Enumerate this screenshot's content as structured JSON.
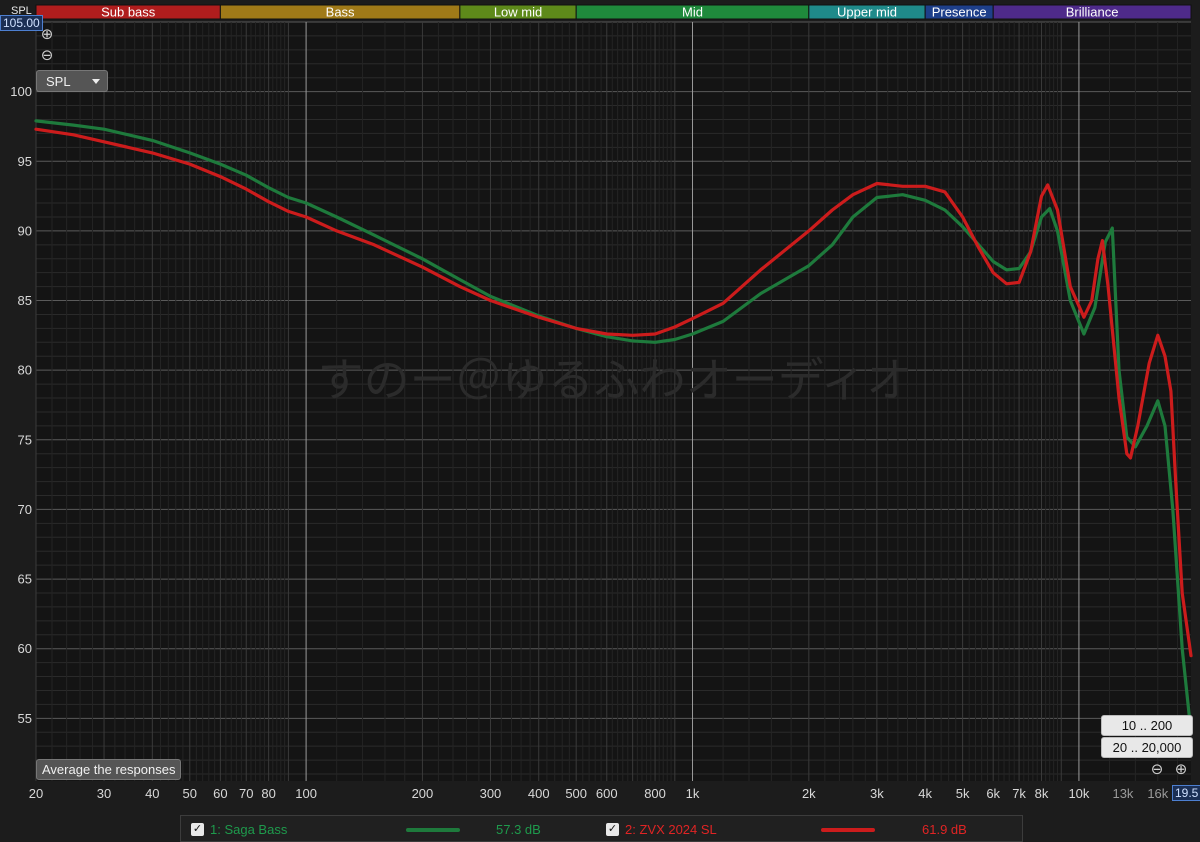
{
  "axis": {
    "title": "SPL",
    "top_value": "105.00",
    "right_value": "19.5"
  },
  "controls": {
    "spl_select": "SPL",
    "average_button": "Average the responses",
    "range_button_1": "10 .. 200",
    "range_button_2": "20 .. 20,000",
    "zoom_in": "⊕",
    "zoom_out": "⊖"
  },
  "bands": [
    {
      "label": "Sub bass",
      "from": 20,
      "to": 60,
      "color": "#b01d1d",
      "text": "#ffffff"
    },
    {
      "label": "Bass",
      "from": 60,
      "to": 250,
      "color": "#a07a18",
      "text": "#ffffff"
    },
    {
      "label": "Low mid",
      "from": 250,
      "to": 500,
      "color": "#5e8a1a",
      "text": "#ffffff"
    },
    {
      "label": "Mid",
      "from": 500,
      "to": 2000,
      "color": "#1f8a3c",
      "text": "#ffffff"
    },
    {
      "label": "Upper mid",
      "from": 2000,
      "to": 4000,
      "color": "#1f8a8a",
      "text": "#ffffff"
    },
    {
      "label": "Presence",
      "from": 4000,
      "to": 6000,
      "color": "#1e3f8a",
      "text": "#ffffff"
    },
    {
      "label": "Brilliance",
      "from": 6000,
      "to": 20000,
      "color": "#4e2a8a",
      "text": "#ffffff"
    }
  ],
  "watermark": "すのー＠ゆるふわオーディオ",
  "chart_data": {
    "type": "line",
    "xscale": "log",
    "xlim": [
      20,
      19500
    ],
    "ylim": [
      50.5,
      105
    ],
    "grid": true,
    "y_ticks": [
      55,
      60,
      65,
      70,
      75,
      80,
      85,
      90,
      95,
      100
    ],
    "x_ticks": [
      {
        "value": 20,
        "label": "20"
      },
      {
        "value": 30,
        "label": "30"
      },
      {
        "value": 40,
        "label": "40"
      },
      {
        "value": 50,
        "label": "50"
      },
      {
        "value": 60,
        "label": "60"
      },
      {
        "value": 70,
        "label": "70"
      },
      {
        "value": 80,
        "label": "80"
      },
      {
        "value": 100,
        "label": "100"
      },
      {
        "value": 200,
        "label": "200"
      },
      {
        "value": 300,
        "label": "300"
      },
      {
        "value": 400,
        "label": "400"
      },
      {
        "value": 500,
        "label": "500"
      },
      {
        "value": 600,
        "label": "600"
      },
      {
        "value": 800,
        "label": "800"
      },
      {
        "value": 1000,
        "label": "1k"
      },
      {
        "value": 2000,
        "label": "2k"
      },
      {
        "value": 3000,
        "label": "3k"
      },
      {
        "value": 4000,
        "label": "4k"
      },
      {
        "value": 5000,
        "label": "5k"
      },
      {
        "value": 6000,
        "label": "6k"
      },
      {
        "value": 7000,
        "label": "7k"
      },
      {
        "value": 8000,
        "label": "8k"
      },
      {
        "value": 10000,
        "label": "10k"
      },
      {
        "value": 13000,
        "label": "13k"
      },
      {
        "value": 16000,
        "label": "16k"
      }
    ],
    "series": [
      {
        "name": "1: Saga Bass",
        "color": "#1e7a3c",
        "legend_value": "57.3 dB",
        "points": [
          [
            20,
            97.9
          ],
          [
            25,
            97.6
          ],
          [
            30,
            97.3
          ],
          [
            40,
            96.5
          ],
          [
            50,
            95.6
          ],
          [
            60,
            94.8
          ],
          [
            70,
            94.0
          ],
          [
            80,
            93.1
          ],
          [
            90,
            92.4
          ],
          [
            100,
            92.0
          ],
          [
            120,
            91.0
          ],
          [
            150,
            89.7
          ],
          [
            200,
            88.0
          ],
          [
            250,
            86.5
          ],
          [
            300,
            85.3
          ],
          [
            400,
            83.9
          ],
          [
            500,
            83.0
          ],
          [
            600,
            82.4
          ],
          [
            700,
            82.1
          ],
          [
            800,
            82.0
          ],
          [
            900,
            82.2
          ],
          [
            1000,
            82.6
          ],
          [
            1200,
            83.5
          ],
          [
            1500,
            85.5
          ],
          [
            2000,
            87.5
          ],
          [
            2300,
            89.0
          ],
          [
            2600,
            91.0
          ],
          [
            3000,
            92.4
          ],
          [
            3500,
            92.6
          ],
          [
            4000,
            92.2
          ],
          [
            4500,
            91.5
          ],
          [
            5000,
            90.3
          ],
          [
            5500,
            89.0
          ],
          [
            6000,
            87.8
          ],
          [
            6500,
            87.2
          ],
          [
            7000,
            87.3
          ],
          [
            7500,
            88.5
          ],
          [
            8000,
            91.0
          ],
          [
            8400,
            91.6
          ],
          [
            8800,
            90.0
          ],
          [
            9500,
            85.0
          ],
          [
            10300,
            82.6
          ],
          [
            11000,
            84.5
          ],
          [
            11700,
            89.2
          ],
          [
            12200,
            90.2
          ],
          [
            12700,
            80.0
          ],
          [
            13300,
            75.2
          ],
          [
            14000,
            74.5
          ],
          [
            15000,
            76.0
          ],
          [
            16000,
            77.8
          ],
          [
            16700,
            76.0
          ],
          [
            17500,
            70.0
          ],
          [
            18500,
            60.0
          ],
          [
            19500,
            54.0
          ]
        ]
      },
      {
        "name": "2: ZVX 2024 SL",
        "color": "#cc1c1c",
        "legend_value": "61.9 dB",
        "points": [
          [
            20,
            97.3
          ],
          [
            25,
            96.9
          ],
          [
            30,
            96.4
          ],
          [
            40,
            95.6
          ],
          [
            50,
            94.8
          ],
          [
            60,
            93.9
          ],
          [
            70,
            93.0
          ],
          [
            80,
            92.1
          ],
          [
            90,
            91.4
          ],
          [
            100,
            91.0
          ],
          [
            120,
            90.0
          ],
          [
            150,
            89.0
          ],
          [
            200,
            87.4
          ],
          [
            250,
            86.0
          ],
          [
            300,
            85.0
          ],
          [
            400,
            83.8
          ],
          [
            500,
            83.0
          ],
          [
            600,
            82.6
          ],
          [
            700,
            82.5
          ],
          [
            800,
            82.6
          ],
          [
            900,
            83.1
          ],
          [
            1000,
            83.7
          ],
          [
            1200,
            84.8
          ],
          [
            1500,
            87.2
          ],
          [
            2000,
            90.0
          ],
          [
            2300,
            91.5
          ],
          [
            2600,
            92.6
          ],
          [
            3000,
            93.4
          ],
          [
            3500,
            93.2
          ],
          [
            4000,
            93.2
          ],
          [
            4500,
            92.8
          ],
          [
            5000,
            91.0
          ],
          [
            5500,
            88.8
          ],
          [
            6000,
            87.0
          ],
          [
            6500,
            86.2
          ],
          [
            7000,
            86.3
          ],
          [
            7500,
            88.5
          ],
          [
            8000,
            92.5
          ],
          [
            8300,
            93.3
          ],
          [
            8800,
            91.5
          ],
          [
            9500,
            86.0
          ],
          [
            10300,
            83.8
          ],
          [
            10800,
            85.0
          ],
          [
            11200,
            88.0
          ],
          [
            11500,
            89.3
          ],
          [
            11900,
            86.0
          ],
          [
            12700,
            78.0
          ],
          [
            13300,
            74.0
          ],
          [
            13600,
            73.7
          ],
          [
            14200,
            76.0
          ],
          [
            15200,
            80.5
          ],
          [
            16000,
            82.5
          ],
          [
            16700,
            81.0
          ],
          [
            17300,
            78.5
          ],
          [
            17800,
            72.0
          ],
          [
            18500,
            64.0
          ],
          [
            19500,
            59.5
          ]
        ]
      }
    ]
  }
}
